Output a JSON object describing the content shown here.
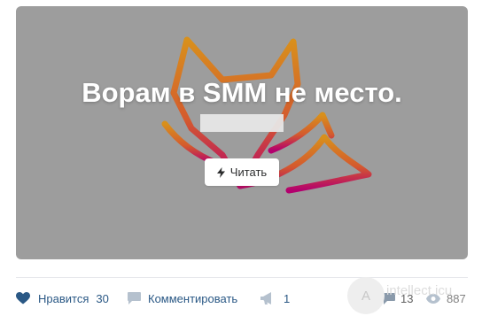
{
  "post": {
    "title": "Ворам в SMM не место.",
    "read_button": "Читать",
    "colors": {
      "background": "#9d9d9d",
      "fox_top": "#d8901c",
      "fox_bottom": "#b3006e"
    }
  },
  "footer": {
    "like_label": "Нравится",
    "like_count": "30",
    "comment_label": "Комментировать",
    "share_count": "1",
    "comments_count": "13",
    "views_count": "887",
    "watermark_letter": "A",
    "watermark_text": "intellect.icu"
  }
}
